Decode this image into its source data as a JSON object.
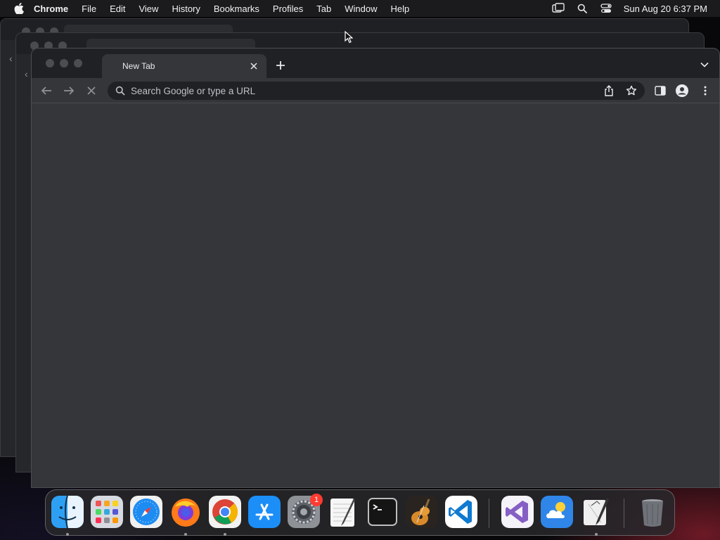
{
  "menubar": {
    "app_name": "Chrome",
    "items": [
      "File",
      "Edit",
      "View",
      "History",
      "Bookmarks",
      "Profiles",
      "Tab",
      "Window",
      "Help"
    ],
    "clock": "Sun Aug 20  6:37 PM",
    "status_icons": [
      "screen-mirroring-icon",
      "spotlight-search-icon",
      "control-center-icon"
    ]
  },
  "browser": {
    "tab": {
      "title": "New Tab"
    },
    "omnibox": {
      "placeholder": "Search Google or type a URL"
    },
    "toolbar_icons": [
      "back-icon",
      "forward-icon",
      "stop-loading-icon",
      "share-icon",
      "bookmark-star-icon",
      "side-panel-icon",
      "profile-icon",
      "more-menu-icon"
    ]
  },
  "dock": {
    "apps": [
      {
        "name": "Finder",
        "running": true
      },
      {
        "name": "Launchpad",
        "running": false
      },
      {
        "name": "Safari",
        "running": false
      },
      {
        "name": "Firefox",
        "running": true
      },
      {
        "name": "Google Chrome",
        "running": true
      },
      {
        "name": "App Store",
        "running": false
      },
      {
        "name": "System Settings",
        "running": false,
        "badge": "1"
      },
      {
        "name": "TextEdit",
        "running": false
      },
      {
        "name": "Terminal",
        "running": false
      },
      {
        "name": "GarageBand",
        "running": false
      },
      {
        "name": "Visual Studio Code",
        "running": false
      },
      {
        "name": "Visual Studio",
        "running": false
      },
      {
        "name": "Weather",
        "running": false
      },
      {
        "name": "Script Editor",
        "running": true
      },
      {
        "name": "Trash",
        "running": false
      }
    ]
  },
  "colors": {
    "menubar_bg": "#1b1b1e",
    "tabstrip_bg": "#202124",
    "toolbar_bg": "#35363a",
    "omnibox_bg": "#202124",
    "badge_red": "#ff3b30"
  }
}
